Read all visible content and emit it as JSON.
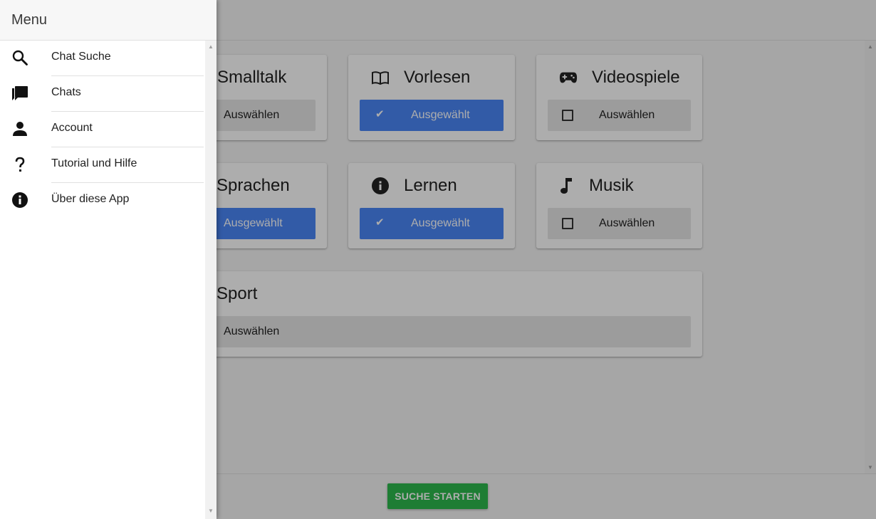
{
  "drawer": {
    "title": "Menu",
    "items": [
      {
        "label": "Chat Suche",
        "icon": "search-icon"
      },
      {
        "label": "Chats",
        "icon": "chats-icon"
      },
      {
        "label": "Account",
        "icon": "account-icon"
      },
      {
        "label": "Tutorial und Hilfe",
        "icon": "help-icon"
      },
      {
        "label": "Über diese App",
        "icon": "info-icon"
      }
    ]
  },
  "topics": [
    {
      "title": "Smalltalk",
      "button": "Auswählen",
      "selected": false,
      "icon": "none"
    },
    {
      "title": "Vorlesen",
      "button": "Ausgewählt",
      "selected": true,
      "icon": "book-icon"
    },
    {
      "title": "Videospiele",
      "button": "Auswählen",
      "selected": false,
      "icon": "gamepad-icon"
    },
    {
      "title": "Sprachen",
      "button": "Ausgewählt",
      "selected": true,
      "icon": "none"
    },
    {
      "title": "Lernen",
      "button": "Ausgewählt",
      "selected": true,
      "icon": "info-icon"
    },
    {
      "title": "Musik",
      "button": "Auswählen",
      "selected": false,
      "icon": "music-note-icon"
    },
    {
      "title": "Sport",
      "button": "Auswählen",
      "selected": false,
      "icon": "none"
    }
  ],
  "footer": {
    "search_label": "SUCHE STARTEN"
  },
  "colors": {
    "selected": "#4a86f7",
    "unselected": "#e6e6e6",
    "search_button": "#2db84d"
  }
}
